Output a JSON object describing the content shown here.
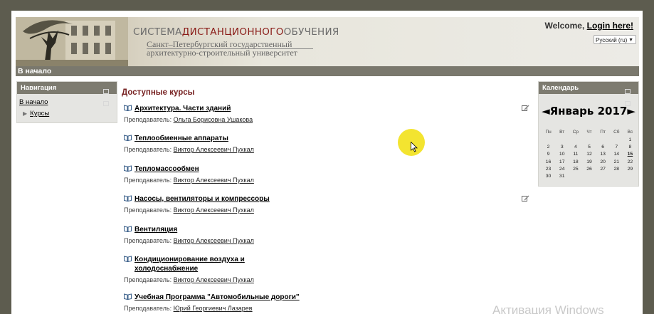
{
  "header": {
    "title_prefix": "СИСТЕМА",
    "title_accent": "ДИСТАНЦИОННОГО",
    "title_suffix": "ОБУЧЕНИЯ",
    "university_line1": "Санкт–Петербургский   государственный",
    "university_line2": "архитектурно-строительный университет",
    "welcome_text": "Welcome,",
    "login_link": "Login here!",
    "language": "Русский (ru)"
  },
  "navbar": {
    "home_label": "В начало"
  },
  "navigation_block": {
    "title": "Навигация",
    "home_link": "В начало",
    "items": [
      "Курсы"
    ]
  },
  "main": {
    "title": "Доступные курсы",
    "courses": [
      {
        "name": "Архитектура. Части зданий",
        "teacher_label": "Преподаватель:",
        "teacher": "Ольга Борисовна Ушакова",
        "editable": true
      },
      {
        "name": "Теплообменные аппараты",
        "teacher_label": "Преподаватель:",
        "teacher": "Виктор Алексеевич Пухкал",
        "editable": false
      },
      {
        "name": "Тепломассообмен",
        "teacher_label": "Преподаватель:",
        "teacher": "Виктор Алексеевич Пухкал",
        "editable": false
      },
      {
        "name": "Насосы, вентиляторы и компрессоры",
        "teacher_label": "Преподаватель:",
        "teacher": "Виктор Алексеевич Пухкал",
        "editable": true
      },
      {
        "name": "Вентиляция",
        "teacher_label": "Преподаватель:",
        "teacher": "Виктор Алексеевич Пухкал",
        "editable": false
      },
      {
        "name": "Кондиционирование воздуха и холодоснабжение",
        "teacher_label": "Преподаватель:",
        "teacher": "Виктор Алексеевич Пухкал",
        "editable": false
      },
      {
        "name": "Учебная Программа \"Автомобильные дороги\"",
        "teacher_label": "Преподаватель:",
        "teacher": "Юрий Георгиевич Лазарев",
        "editable": false
      }
    ]
  },
  "calendar": {
    "title": "Календарь",
    "prev_arrow": "◄",
    "month": "Январь 2017",
    "next_arrow": "►",
    "weekdays": [
      "Пн",
      "Вт",
      "Ср",
      "Чт",
      "Пт",
      "Сб",
      "Вс"
    ],
    "weeks": [
      [
        "",
        "",
        "",
        "",
        "",
        "",
        "1"
      ],
      [
        "2",
        "3",
        "4",
        "5",
        "6",
        "7",
        "8"
      ],
      [
        "9",
        "10",
        "11",
        "12",
        "13",
        "14",
        "15"
      ],
      [
        "16",
        "17",
        "18",
        "19",
        "20",
        "21",
        "22"
      ],
      [
        "23",
        "24",
        "25",
        "26",
        "27",
        "28",
        "29"
      ],
      [
        "30",
        "31",
        "",
        "",
        "",
        "",
        ""
      ]
    ],
    "today": "15"
  },
  "watermark": "Активация Windows"
}
